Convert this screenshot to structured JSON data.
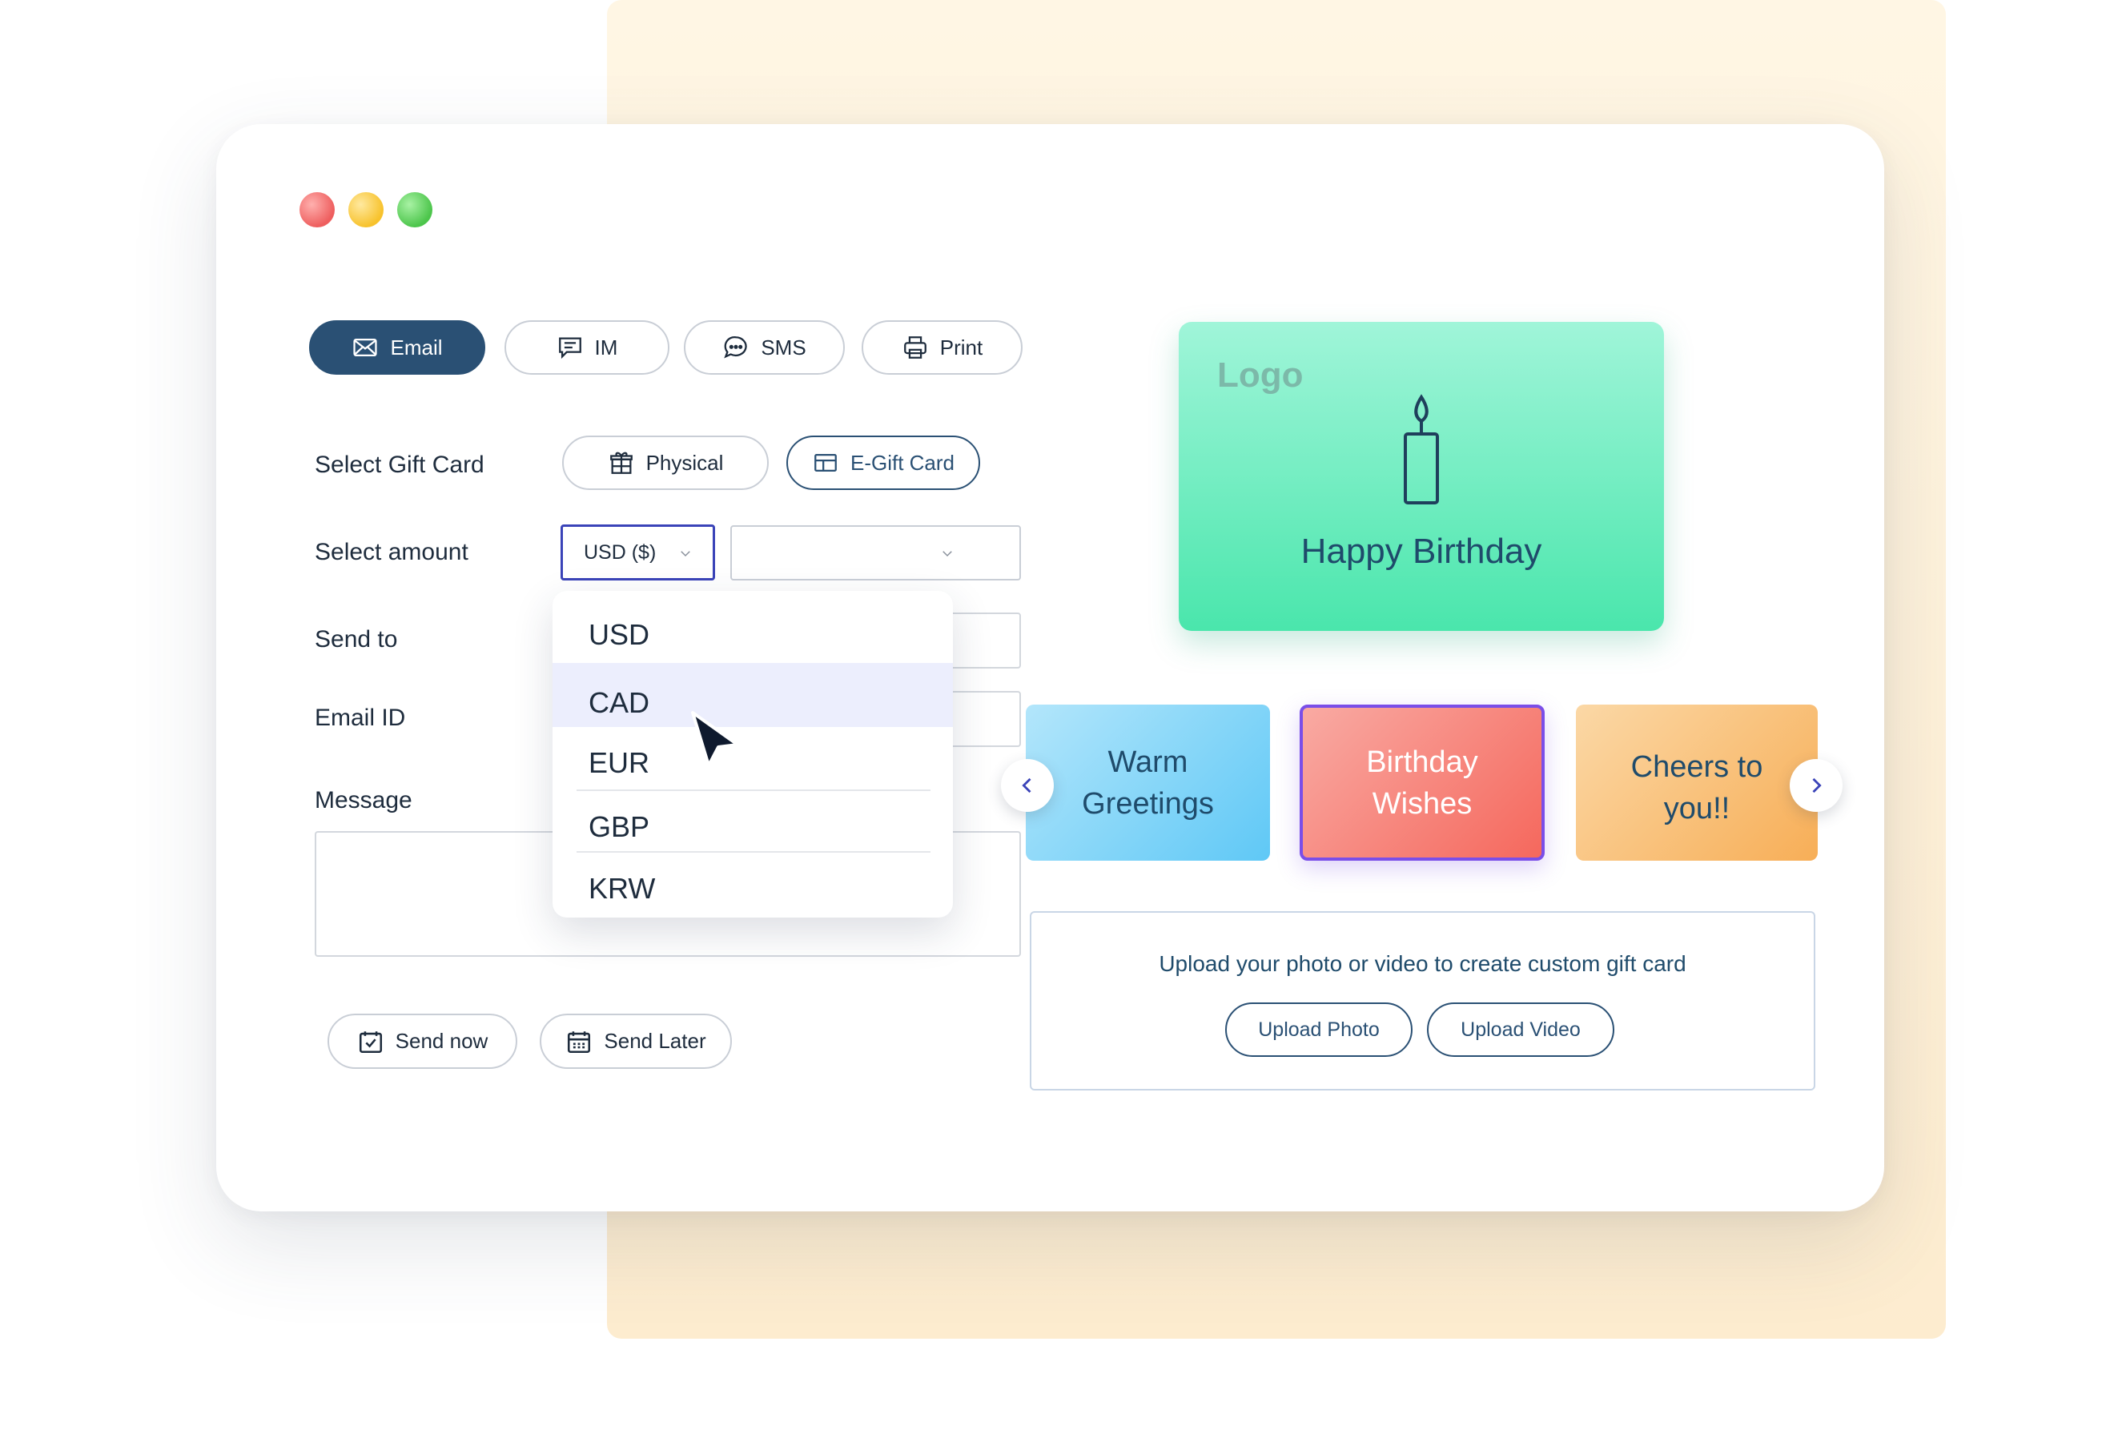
{
  "channels": [
    {
      "label": "Email",
      "icon": "mail-icon",
      "active": true
    },
    {
      "label": "IM",
      "icon": "message-icon",
      "active": false
    },
    {
      "label": "SMS",
      "icon": "chat-icon",
      "active": false
    },
    {
      "label": "Print",
      "icon": "printer-icon",
      "active": false
    }
  ],
  "form": {
    "select_gift_card_label": "Select Gift Card",
    "gift_types": [
      {
        "label": "Physical",
        "icon": "gift-icon",
        "selected": false
      },
      {
        "label": "E-Gift Card",
        "icon": "card-icon",
        "selected": true
      }
    ],
    "select_amount_label": "Select amount",
    "currency_value": "USD ($)",
    "amount_value": "",
    "send_to_label": "Send to",
    "email_id_label": "Email ID",
    "message_label": "Message"
  },
  "currency_dropdown": {
    "options": [
      "USD",
      "CAD",
      "EUR",
      "GBP",
      "KRW"
    ],
    "highlighted": "CAD"
  },
  "actions": {
    "send_now": "Send now",
    "send_later": "Send Later"
  },
  "preview": {
    "logo": "Logo",
    "greeting": "Happy Birthday"
  },
  "templates": [
    {
      "line1": "Warm",
      "line2": "Greetings"
    },
    {
      "line1": "Birthday",
      "line2": "Wishes",
      "selected": true
    },
    {
      "line1": "Cheers to",
      "line2": "you!!"
    }
  ],
  "upload": {
    "prompt": "Upload your photo or video to create custom gift card",
    "photo_button": "Upload Photo",
    "video_button": "Upload Video"
  },
  "colors": {
    "accent_dark": "#2a5074",
    "focus_border": "#3a43b8",
    "selected_template_border": "#7a4ee8"
  }
}
